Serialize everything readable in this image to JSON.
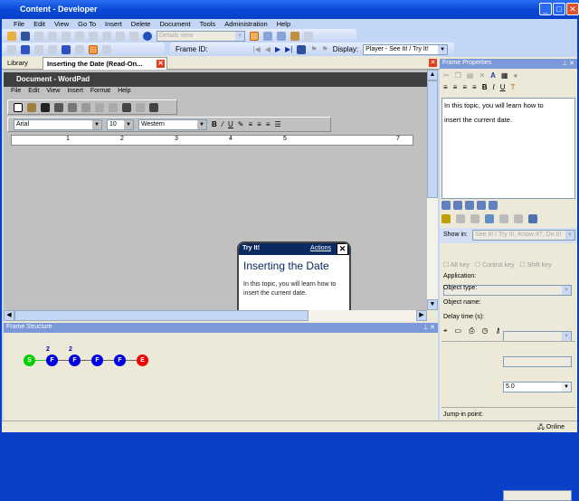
{
  "window": {
    "title": "Content - Developer"
  },
  "menu": [
    "File",
    "Edit",
    "View",
    "Go To",
    "Insert",
    "Delete",
    "Document",
    "Tools",
    "Administration",
    "Help"
  ],
  "toolbar": {
    "view_combo": "Details view",
    "frame_id_label": "Frame ID:",
    "display_label": "Display:",
    "display_value": "Player - See It! / Try It!"
  },
  "tabs": [
    {
      "label": "Library"
    },
    {
      "label": "Inserting the Date (Read-On..."
    }
  ],
  "wordpad": {
    "title": "Document - WordPad",
    "menu": [
      "File",
      "Edit",
      "View",
      "Insert",
      "Format",
      "Help"
    ],
    "font": "Arial",
    "size": "10",
    "script": "Western",
    "ruler": [
      "1",
      "2",
      "3",
      "4",
      "5",
      "7"
    ]
  },
  "tryit": {
    "header": "Try It!",
    "actions": "Actions",
    "title": "Inserting the Date",
    "body": "In this topic, you will learn how to insert the current date."
  },
  "frame_structure": {
    "title": "Frame Structure",
    "nodes": [
      {
        "label": "S",
        "color": "#00d000",
        "badge": ""
      },
      {
        "label": "F",
        "color": "#0000e0",
        "badge": "2"
      },
      {
        "label": "F",
        "color": "#0000e0",
        "badge": "2"
      },
      {
        "label": "F",
        "color": "#0000e0",
        "badge": ""
      },
      {
        "label": "F",
        "color": "#0000e0",
        "badge": ""
      },
      {
        "label": "E",
        "color": "#f00000",
        "badge": ""
      }
    ]
  },
  "frame_properties": {
    "title": "Frame Properties",
    "text": "In this topic, you will learn how to insert the current date.",
    "show_in_label": "Show in:",
    "show_in_value": "See It! / Try It!, Know It?, Do It!",
    "alt_key": "Alt key",
    "control_key": "Control key",
    "shift_key": "Shift key",
    "application_label": "Application:",
    "object_type_label": "Object type:",
    "object_name_label": "Object name:",
    "delay_label": "Delay time (s):",
    "delay_value": "5.0",
    "jump_in_label": "Jump-in point:"
  },
  "status": {
    "online": "Online"
  }
}
